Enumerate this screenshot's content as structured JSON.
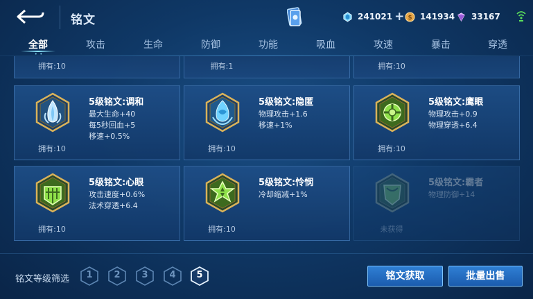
{
  "header": {
    "title": "铭文",
    "resources": [
      {
        "icon": "diamond-gem-icon",
        "value": "241021",
        "has_plus": true,
        "color": "#7fd8ff"
      },
      {
        "icon": "gold-coin-icon",
        "value": "141934",
        "has_plus": false,
        "color": "#e9a94a"
      },
      {
        "icon": "purple-crystal-icon",
        "value": "33167",
        "has_plus": false,
        "color": "#c78cf5"
      }
    ],
    "plus_label": "+"
  },
  "tabs": [
    {
      "label": "全部",
      "active": true
    },
    {
      "label": "攻击",
      "active": false
    },
    {
      "label": "生命",
      "active": false
    },
    {
      "label": "防御",
      "active": false
    },
    {
      "label": "功能",
      "active": false
    },
    {
      "label": "吸血",
      "active": false
    },
    {
      "label": "攻速",
      "active": false
    },
    {
      "label": "暴击",
      "active": false
    },
    {
      "label": "穿透",
      "active": false
    }
  ],
  "tab_indicator": "• •",
  "partial_row": [
    {
      "owned": "拥有:10"
    },
    {
      "owned": "拥有:1"
    },
    {
      "owned": "拥有:10"
    }
  ],
  "cards": [
    {
      "name": "5级铭文:调和",
      "attrs": [
        "最大生命+40",
        "每5秒回血+5",
        "移速+0.5%"
      ],
      "owned": "拥有:10",
      "emblem": "harmony-emblem-icon",
      "obtained": true,
      "color": "#bfe6ff"
    },
    {
      "name": "5级铭文:隐匿",
      "attrs": [
        "物理攻击+1.6",
        "移速+1%"
      ],
      "owned": "拥有:10",
      "emblem": "stealth-emblem-icon",
      "obtained": true,
      "color": "#6fd2ff"
    },
    {
      "name": "5级铭文:鹰眼",
      "attrs": [
        "物理攻击+0.9",
        "物理穿透+6.4"
      ],
      "owned": "拥有:10",
      "emblem": "hawkeye-emblem-icon",
      "obtained": true,
      "color": "#8fe04a"
    },
    {
      "name": "5级铭文:心眼",
      "attrs": [
        "攻击速度+0.6%",
        "法术穿透+6.4"
      ],
      "owned": "拥有:10",
      "emblem": "mind-eye-emblem-icon",
      "obtained": true,
      "color": "#8fe04a"
    },
    {
      "name": "5级铭文:怜悯",
      "attrs": [
        "冷却缩减+1%"
      ],
      "owned": "拥有:10",
      "emblem": "mercy-emblem-icon",
      "obtained": true,
      "color": "#8fe04a"
    },
    {
      "name": "5级铭文:霸者",
      "attrs": [
        "物理防御+14"
      ],
      "owned": "未获得",
      "emblem": "overlord-emblem-icon",
      "obtained": false,
      "color": "#7fd06a"
    }
  ],
  "footer": {
    "filter_label": "铭文等级筛选",
    "levels": [
      {
        "label": "1",
        "active": false
      },
      {
        "label": "2",
        "active": false
      },
      {
        "label": "3",
        "active": false
      },
      {
        "label": "4",
        "active": false
      },
      {
        "label": "5",
        "active": true
      }
    ],
    "obtain_button": "铭文获取",
    "sell_button": "批量出售"
  }
}
